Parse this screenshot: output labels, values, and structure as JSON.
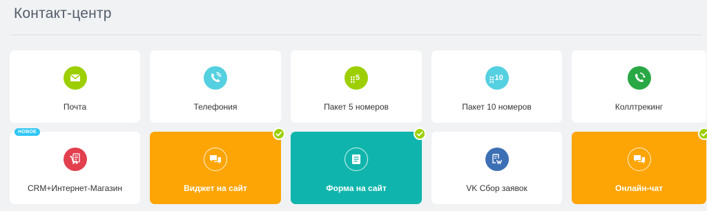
{
  "header": {
    "title": "Контакт-центр"
  },
  "tiles": [
    {
      "label": "Почта",
      "icon": "mail-icon",
      "color": "#9dcf00"
    },
    {
      "label": "Телефония",
      "icon": "phone-icon",
      "color": "#55d0e0"
    },
    {
      "label": "Пакет 5 номеров",
      "icon": "five-numbers-icon",
      "number": "5",
      "color": "#9dcf00"
    },
    {
      "label": "Пакет 10 номеров",
      "icon": "ten-numbers-icon",
      "number": "10",
      "color": "#55d0e0"
    },
    {
      "label": "Коллтрекинг",
      "icon": "calltracking-icon",
      "color": "#29a845"
    },
    {
      "label": "CRM+Интернет-Магазин",
      "icon": "shop-cart-icon",
      "badge": "НОВОЕ",
      "color": "#e23f4f"
    },
    {
      "label": "Виджет на сайт",
      "icon": "chat-bubbles-icon",
      "connected": true,
      "color": "#fda505"
    },
    {
      "label": "Форма на сайт",
      "icon": "form-icon",
      "connected": true,
      "color": "#0fb5ac"
    },
    {
      "label": "VK Сбор заявок",
      "icon": "vk-leads-icon",
      "color": "#3d6fb5"
    },
    {
      "label": "Онлайн-чат",
      "icon": "chat-bubbles-icon",
      "connected": true,
      "color": "#fda505"
    }
  ]
}
